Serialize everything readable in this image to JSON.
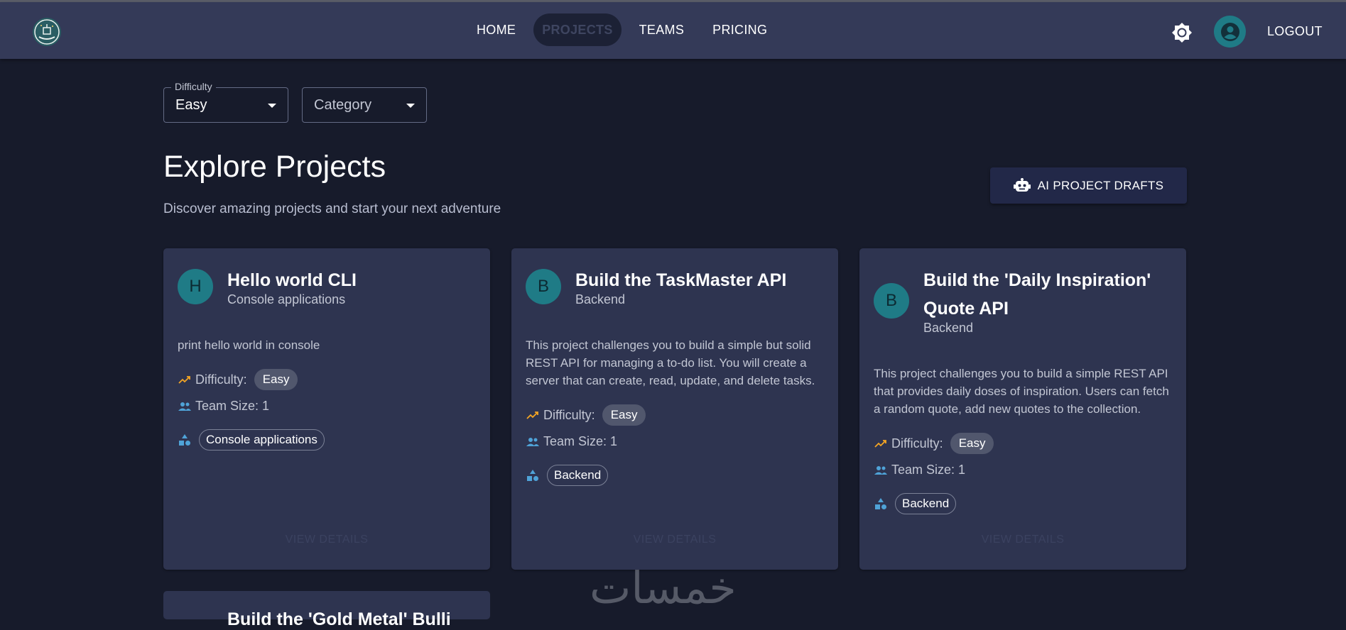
{
  "nav": {
    "links": [
      "HOME",
      "PROJECTS",
      "TEAMS",
      "PRICING"
    ],
    "active": "PROJECTS",
    "logout": "LOGOUT"
  },
  "filters": {
    "difficulty_legend": "Difficulty",
    "difficulty_value": "Easy",
    "category_placeholder": "Category"
  },
  "header": {
    "title": "Explore Projects",
    "subtitle": "Discover amazing projects and start your next adventure",
    "ai_button": "AI PROJECT DRAFTS"
  },
  "labels": {
    "difficulty": "Difficulty:",
    "view_details": "VIEW DETAILS"
  },
  "projects": [
    {
      "initial": "H",
      "title": "Hello world CLI",
      "category": "Console applications",
      "description": "print hello world in console",
      "difficulty": "Easy",
      "team_size": "Team Size: 1",
      "tag": "Console applications"
    },
    {
      "initial": "B",
      "title": "Build the TaskMaster API",
      "category": "Backend",
      "description": "This project challenges you to build a simple but solid REST API for managing a to-do list. You will create a server that can create, read, update, and delete tasks.",
      "difficulty": "Easy",
      "team_size": "Team Size: 1",
      "tag": "Backend"
    },
    {
      "initial": "B",
      "title": "Build the 'Daily Inspiration' Quote API",
      "category": "Backend",
      "description": "This project challenges you to build a simple REST API that provides daily doses of inspiration. Users can fetch a random quote, add new quotes to the collection.",
      "difficulty": "Easy",
      "team_size": "Team Size: 1",
      "tag": "Backend"
    }
  ],
  "partial_card_title": "Build the 'Gold Metal' Bulli",
  "watermark": "خمسات",
  "colors": {
    "background": "#171b2b",
    "navbar": "#343a58",
    "card": "#2e3450",
    "accent": "#1f7b86",
    "difficulty_icon": "#f5a623",
    "info_icon": "#4fa3d8"
  }
}
